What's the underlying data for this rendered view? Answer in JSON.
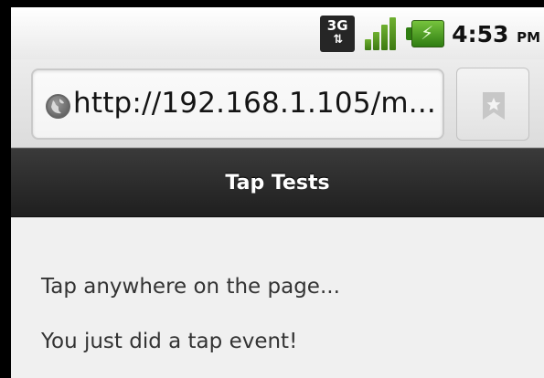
{
  "status_bar": {
    "network_type": "3G",
    "network_arrows": "⇅",
    "clock_time": "4:53",
    "clock_ampm": "PM",
    "icons": [
      "network-3g-icon",
      "signal-strength-icon",
      "battery-charging-icon"
    ],
    "signal_color": "#4a9a1c",
    "battery_color": "#2f7d12"
  },
  "browser": {
    "url": "http://192.168.1.105/m...",
    "icons": [
      "globe-icon",
      "bookmark-star-icon"
    ]
  },
  "page": {
    "header_title": "Tap Tests",
    "lines": [
      "Tap anywhere on the page...",
      "You just did a tap event!"
    ]
  }
}
